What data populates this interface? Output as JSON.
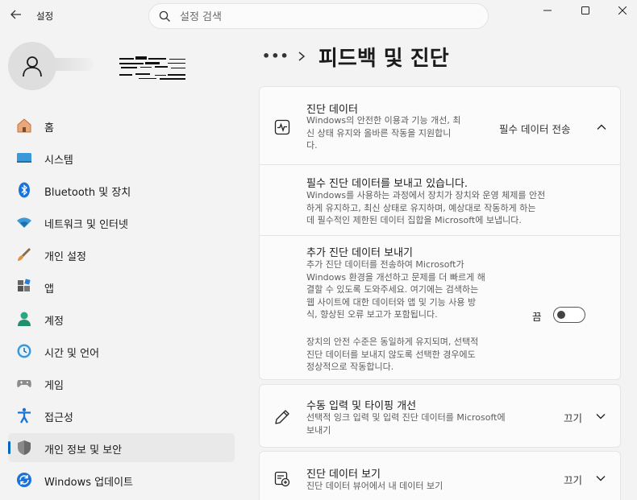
{
  "app": {
    "title": "설정"
  },
  "search": {
    "placeholder": "설정 검색"
  },
  "breadcrumb": {
    "ellipsis": "•••",
    "title": "피드백 및 진단"
  },
  "nav": [
    {
      "label": "홈",
      "icon": "home-icon"
    },
    {
      "label": "시스템",
      "icon": "system-icon"
    },
    {
      "label": "Bluetooth 및 장치",
      "icon": "bluetooth-icon"
    },
    {
      "label": "네트워크 및 인터넷",
      "icon": "wifi-icon"
    },
    {
      "label": "개인 설정",
      "icon": "brush-icon"
    },
    {
      "label": "앱",
      "icon": "apps-icon"
    },
    {
      "label": "계정",
      "icon": "account-icon"
    },
    {
      "label": "시간 및 언어",
      "icon": "time-language-icon"
    },
    {
      "label": "게임",
      "icon": "gamepad-icon"
    },
    {
      "label": "접근성",
      "icon": "accessibility-icon"
    },
    {
      "label": "개인 정보 및 보안",
      "icon": "shield-icon",
      "active": true
    },
    {
      "label": "Windows 업데이트",
      "icon": "update-icon"
    }
  ],
  "diagnostic": {
    "title": "진단 데이터",
    "desc": [
      "Windows의 안전한 이용과 기능 개선, 최",
      "신 상태 유지와 올바른 작동을 지원합니",
      "다."
    ],
    "status": "필수 데이터 전송",
    "required": {
      "title": "필수 진단 데이터를 보내고 있습니다.",
      "desc": [
        "Windows를 사용하는 과정에서 장치가 장치와 운영 체제를 안전",
        "하게 유지하고, 최신 상태로 유지하며, 예상대로 작동하게 하는",
        "데 필수적인 제한된 데이터 집합을 Microsoft에 보냅니다."
      ]
    },
    "optional": {
      "title": "추가 진단 데이터 보내기",
      "desc": [
        "추가 진단 데이터를 전송하여 Microsoft가",
        "Windows 환경을 개선하고 문제를 더 빠르게 해",
        "결할 수 있도록 도와주세요. 여기에는 검색하는",
        "웹 사이트에 대한 데이터와 앱 및 기능 사용 방",
        "식, 향상된 오류 보고가 포함됩니다."
      ],
      "note": [
        "장치의 안전 수준은 동일하게 유지되며, 선택적",
        "진단 데이터를 보내지 않도록 선택한 경우에도",
        "정상적으로 작동합니다."
      ],
      "toggle_label": "끔"
    }
  },
  "handwriting": {
    "title": "수동 입력 및 타이핑 개선",
    "desc": [
      "선택적 잉크 입력 및 입력 진단 데이터를 Microsoft에",
      "보내기"
    ],
    "status": "끄기"
  },
  "viewer": {
    "title": "진단 데이터 보기",
    "desc": [
      "진단 데이터 뷰어에서 내 데이터 보기"
    ],
    "status": "끄기"
  },
  "colors": {
    "accent": "#0067c0",
    "background": "#f3f3f3",
    "card": "#fbfbfb"
  }
}
